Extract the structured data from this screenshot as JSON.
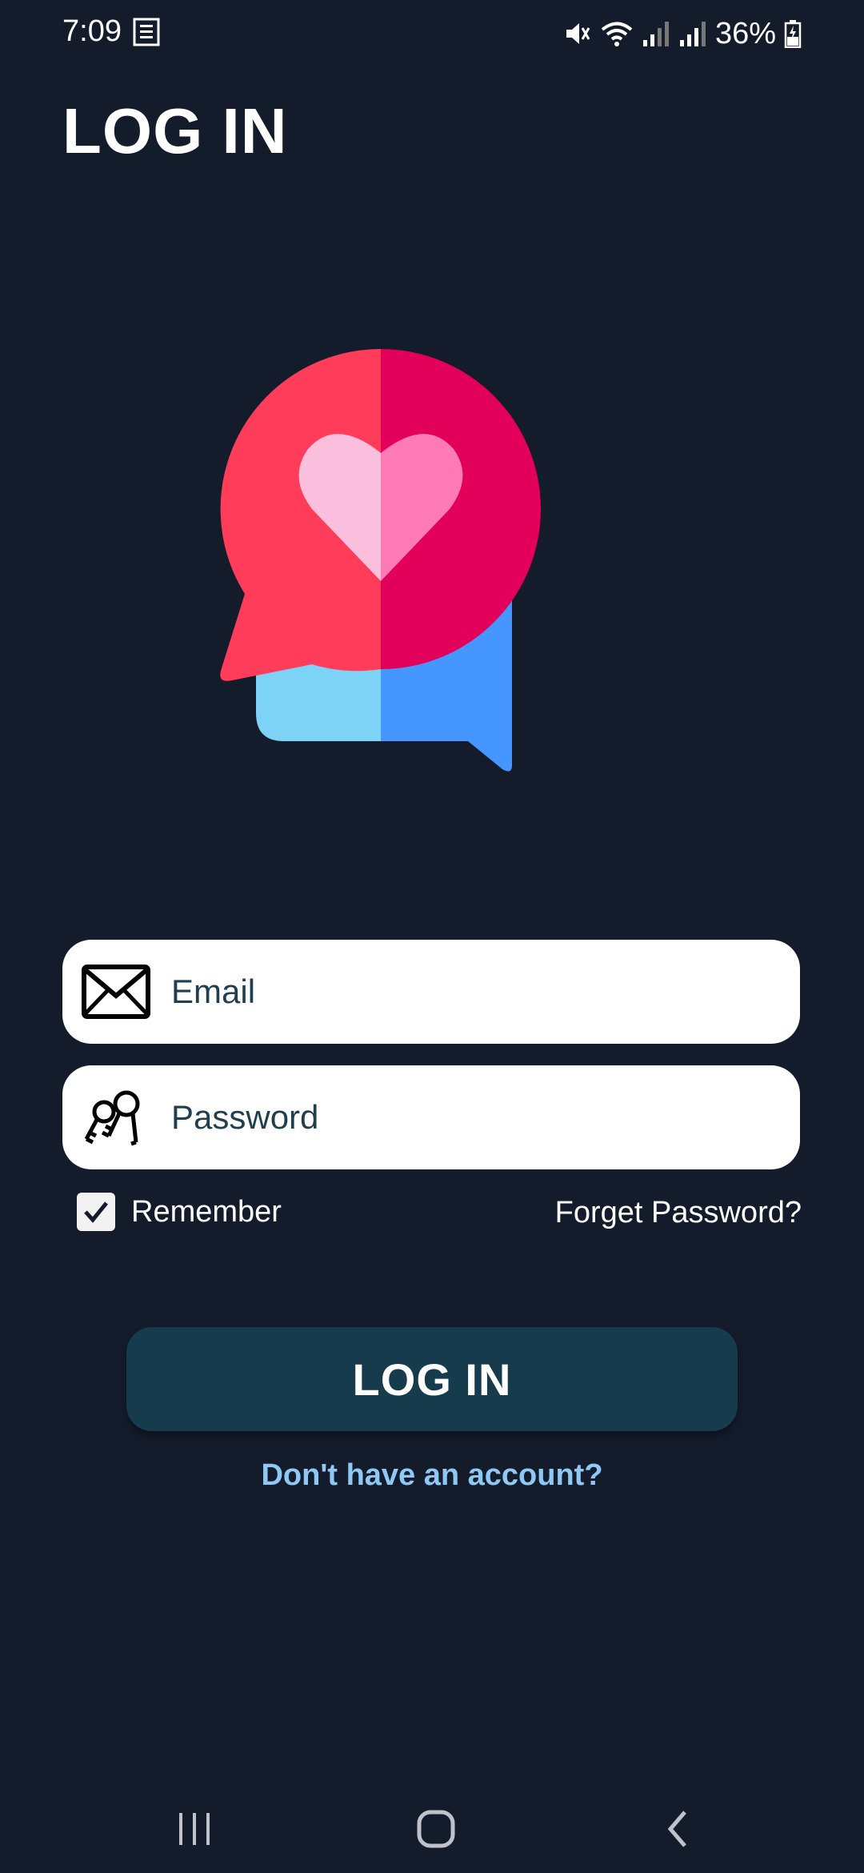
{
  "status_bar": {
    "time": "7:09",
    "battery": "36%",
    "icons": [
      "note-icon",
      "mute-icon",
      "wifi-icon",
      "signal-icon",
      "signal-icon",
      "battery-charging-icon"
    ]
  },
  "header": {
    "title": "LOG IN"
  },
  "logo": {
    "icon": "chat-heart-logo-icon"
  },
  "form": {
    "email": {
      "placeholder": "Email",
      "value": "",
      "icon": "envelope-icon"
    },
    "password": {
      "placeholder": "Password",
      "value": "",
      "icon": "keys-icon"
    },
    "remember": {
      "label": "Remember",
      "checked": true
    },
    "forgot_label": "Forget Password?"
  },
  "actions": {
    "login_label": "LOG IN",
    "signup_label": "Don't have an account?"
  },
  "nav": {
    "buttons": [
      "recents-icon",
      "home-icon",
      "back-icon"
    ]
  },
  "colors": {
    "background": "#141b2b",
    "button": "#163b4d",
    "link": "#8ec8f5",
    "bubble_red": "#ff3d5a",
    "bubble_magenta": "#e3005a",
    "bubble_blue": "#4596ff",
    "bubble_light_blue": "#7dd3f5"
  }
}
